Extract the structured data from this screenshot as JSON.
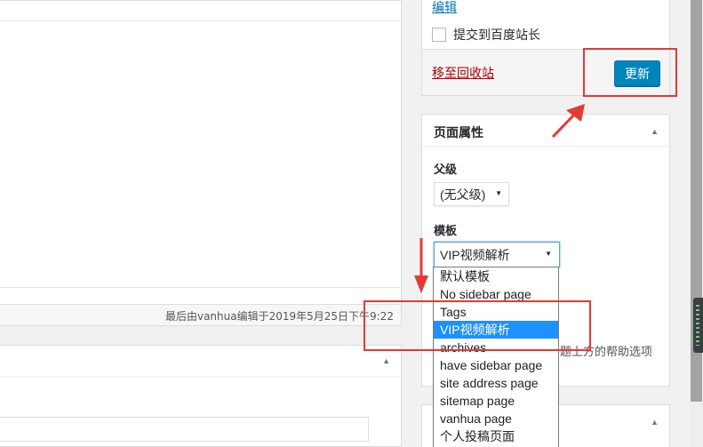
{
  "status_bar": {
    "last_edited": "最后由vanhua编辑于2019年5月25日下午9:22"
  },
  "publish": {
    "edit_link": "编辑",
    "baidu_checkbox_label": "提交到百度站长",
    "trash_link": "移至回收站",
    "update_button": "更新"
  },
  "page_attributes": {
    "title": "页面属性",
    "parent_label": "父级",
    "parent_value": "(无父级)",
    "template_label": "模板",
    "template_value": "VIP视频解析",
    "help_text": "题上方的帮助选项"
  },
  "template_options": [
    "默认模板",
    "No sidebar page",
    "Tags",
    "VIP视频解析",
    "archives",
    "have sidebar page",
    "site address page",
    "sitemap page",
    "vanhua page",
    "个人投稿页面"
  ],
  "selected_option_index": 3,
  "colors": {
    "primary_button": "#0085ba",
    "link": "#0073aa",
    "trash": "#a00",
    "highlight": "#1e90ff",
    "annotation": "#e53935"
  }
}
